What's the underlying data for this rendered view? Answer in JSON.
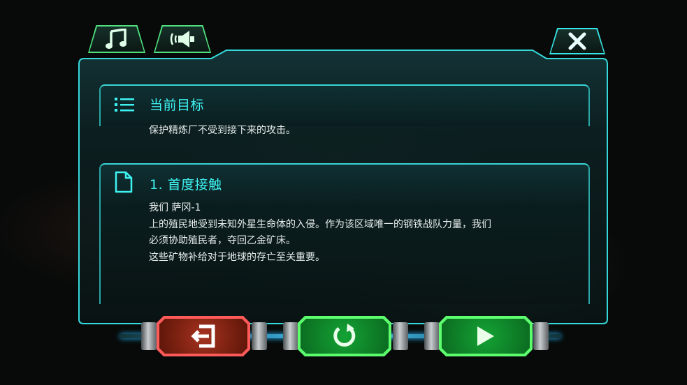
{
  "objective": {
    "title": "当前目标",
    "text": "保护精炼厂不受到接下来的攻击。",
    "icon": "list-icon"
  },
  "briefing": {
    "title": "1. 首度接触",
    "icon": "document-icon",
    "lines": [
      "我们 萨冈-1",
      "上的殖民地受到未知外星生命体的入侵。作为该区域唯一的钢铁战队力量，我们",
      "必须协助殖民者，夺回乙金矿床。",
      "",
      "这些矿物补给对于地球的存亡至关重要。"
    ]
  },
  "top_buttons": [
    "music-icon",
    "sound-icon",
    "close-icon"
  ],
  "bottom_buttons": [
    "exit-icon",
    "restart-icon",
    "play-icon"
  ],
  "colors": {
    "accent": "#3ff2f2",
    "exit": "#ff5a5a",
    "green": "#5dff6f"
  }
}
